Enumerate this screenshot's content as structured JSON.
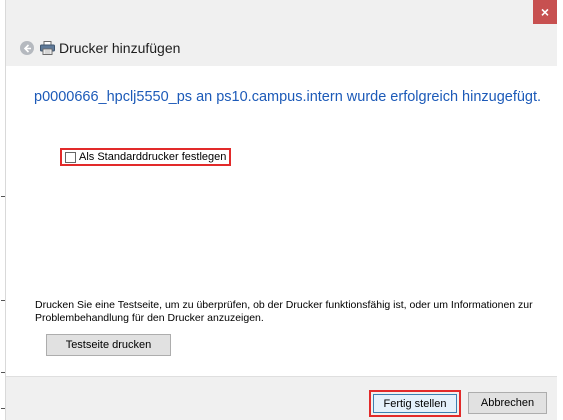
{
  "window": {
    "close_symbol": "×",
    "title": "Drucker hinzufügen",
    "icons": {
      "back": "back-arrow-icon",
      "printer": "printer-icon",
      "close": "close-icon"
    }
  },
  "content": {
    "success_message": "p0000666_hpclj5550_ps an ps10.campus.intern wurde erfolgreich hinzugefügt.",
    "default_printer_checkbox": {
      "label": "Als Standarddrucker festlegen",
      "checked": false
    },
    "info_text": "Drucken Sie eine Testseite, um zu überprüfen, ob der Drucker funktionsfähig ist, oder um Informationen zur Problembehandlung für den Drucker anzuzeigen.",
    "test_button": "Testseite drucken"
  },
  "footer": {
    "finish_button": "Fertig stellen",
    "cancel_button": "Abbrechen"
  },
  "colors": {
    "accent_blue": "#1c5ab8",
    "highlight_red": "#e22a2a",
    "close_red": "#c75050"
  }
}
